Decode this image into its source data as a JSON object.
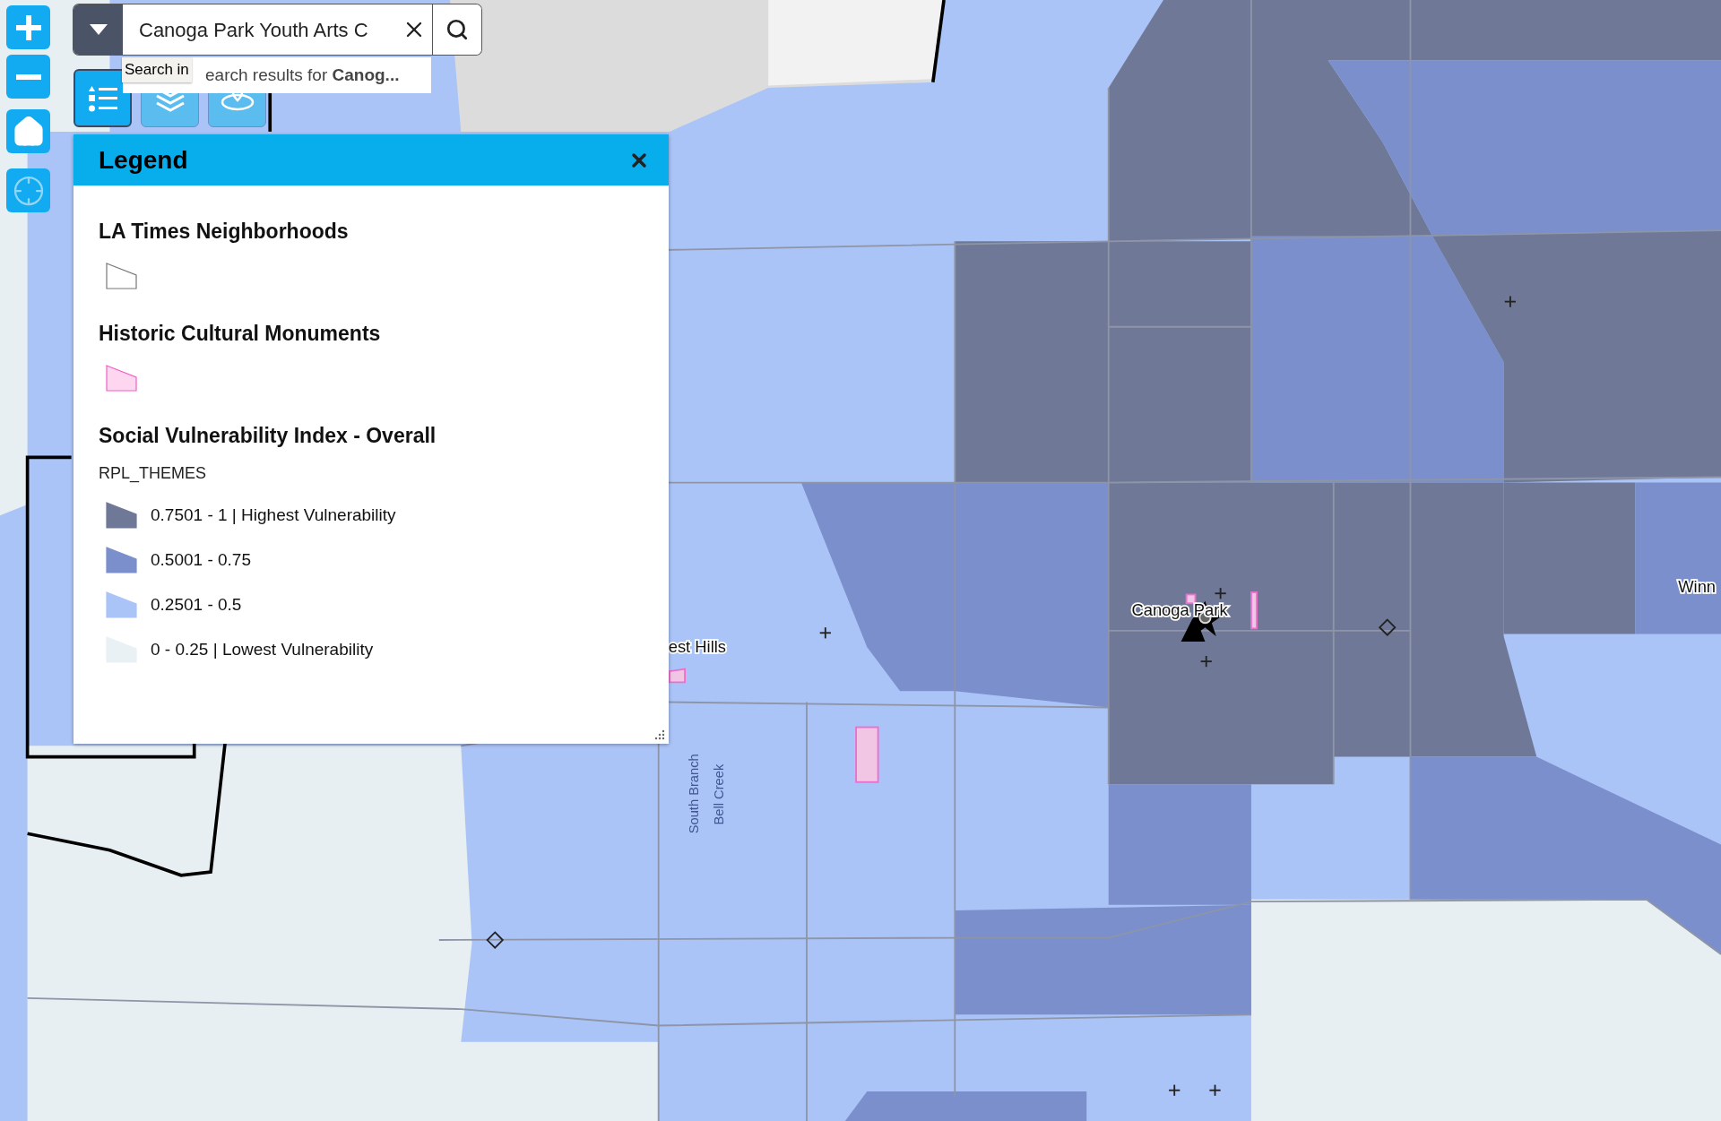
{
  "map_controls": [
    {
      "kind": "zoom_in"
    },
    {
      "kind": "zoom_out"
    },
    {
      "kind": "home"
    },
    {
      "kind": "locate"
    }
  ],
  "search": {
    "value": "Canoga Park Youth Arts C",
    "tooltip": "Search in",
    "suggestion": "earch results for **Canog...**"
  },
  "tools": [
    {
      "kind": "legend",
      "selected": true
    },
    {
      "kind": "layers",
      "selected": false
    },
    {
      "kind": "locate",
      "selected": false
    }
  ],
  "legend": {
    "title": "Legend",
    "layers": [
      {
        "title": "LA Times Neighborhoods",
        "kind": "outline"
      },
      {
        "title": "Historic Cultural Monuments",
        "kind": "monument"
      },
      {
        "title": "Social Vulnerability Index - Overall",
        "kind": "classes",
        "field": "RPL_THEMES",
        "classes": [
          {
            "label": "0.7501 - 1 | Highest Vulnerability",
            "color": "#6f7997"
          },
          {
            "label": "0.5001 - 0.75",
            "color": "#7a8fcc"
          },
          {
            "label": "0.2501 - 0.5",
            "color": "#abc4f7"
          },
          {
            "label": "0 - 0.25 | Lowest Vulnerability",
            "color": "#e9f1f4"
          }
        ]
      }
    ]
  },
  "map_labels": [
    {
      "text": "Canoga Park",
      "kind": "place"
    },
    {
      "text": "est Hills",
      "kind": "place"
    },
    {
      "text": "Winn",
      "kind": "place"
    },
    {
      "text": "South Branch",
      "kind": "stream"
    },
    {
      "text": "Bell Creek",
      "kind": "stream"
    }
  ]
}
